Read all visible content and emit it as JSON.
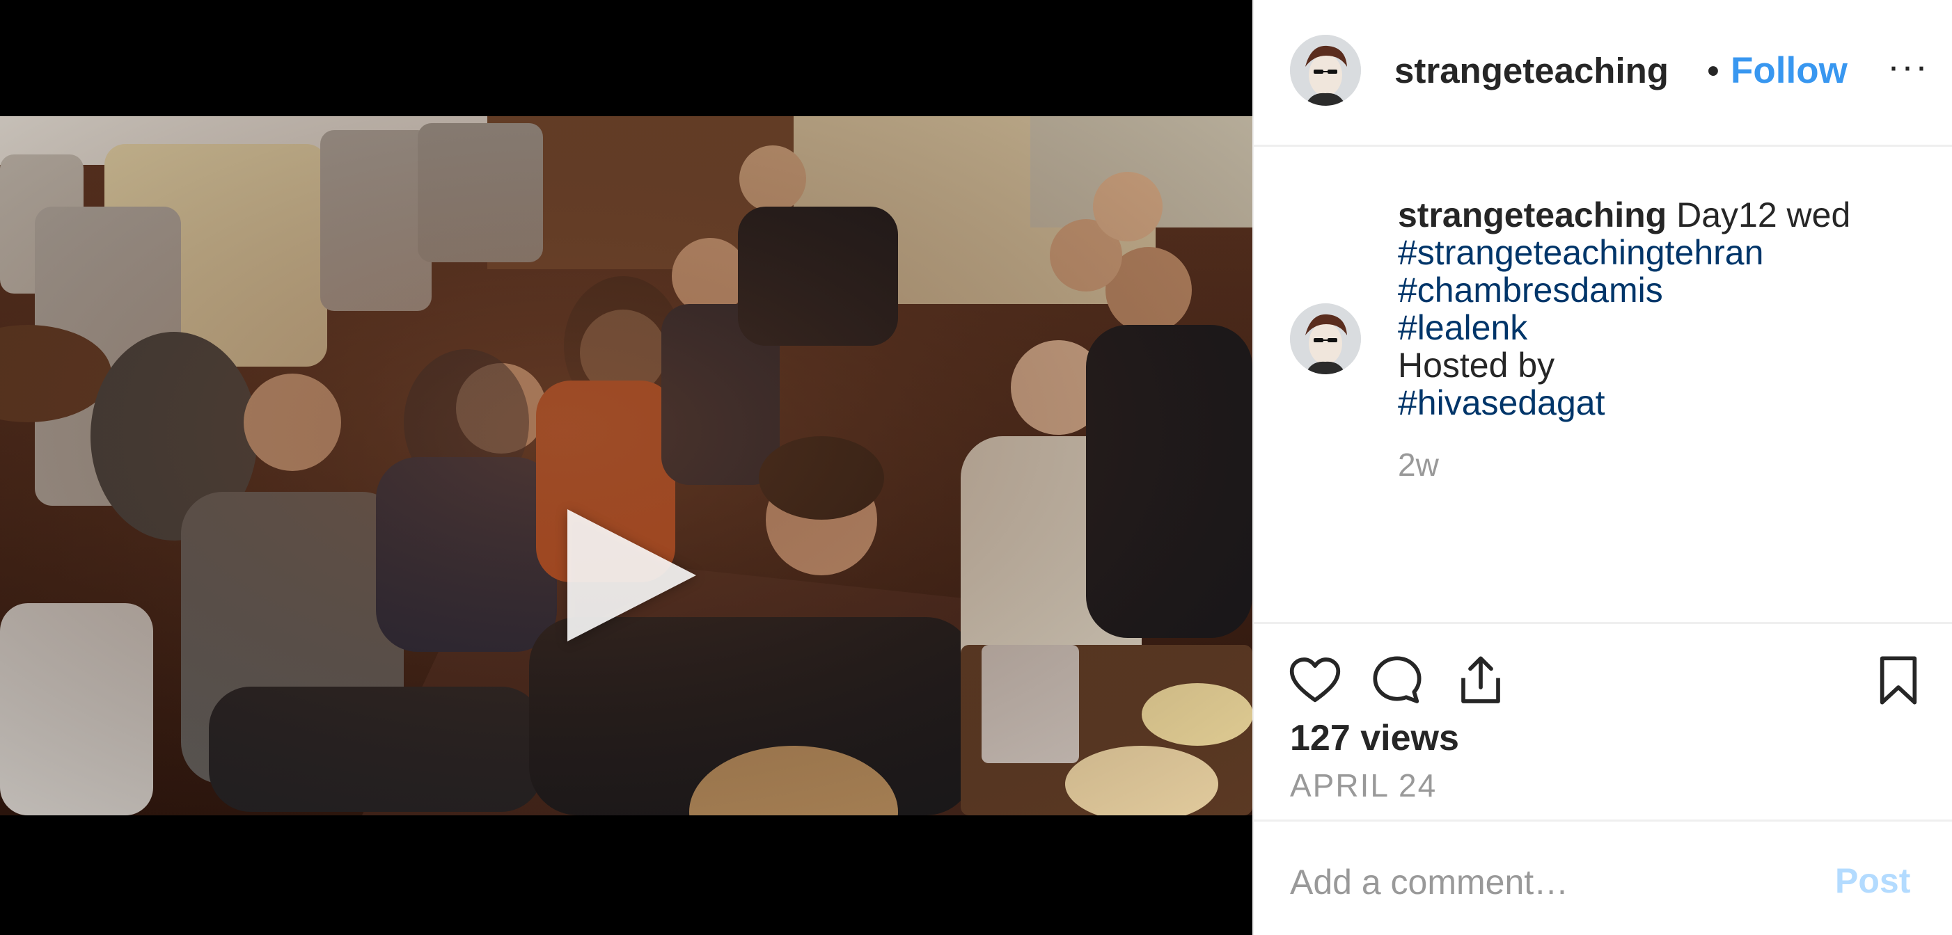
{
  "post": {
    "username": "strangeteaching",
    "separator": "•",
    "follow_label": "Follow",
    "more_label": "···",
    "media_type": "video",
    "play_icon": "play-icon"
  },
  "caption": {
    "username": "strangeteaching",
    "text": "Day12 wed",
    "hashtags": [
      "#strangeteachingtehran",
      "#chambresdamis",
      "#lealenk"
    ],
    "hosted_by": "Hosted by",
    "host_tag": "#hivasedagat",
    "time_ago": "2w"
  },
  "actions": {
    "like_icon": "heart-icon",
    "comment_icon": "comment-icon",
    "share_icon": "share-icon",
    "save_icon": "bookmark-icon"
  },
  "stats": {
    "views": "127 views",
    "date": "APRIL 24"
  },
  "comment": {
    "placeholder": "Add a comment…",
    "post_label": "Post"
  },
  "colors": {
    "link_blue": "#3897f0",
    "hashtag_navy": "#003569",
    "muted_gray": "#999999",
    "post_disabled": "#b3dbff"
  }
}
